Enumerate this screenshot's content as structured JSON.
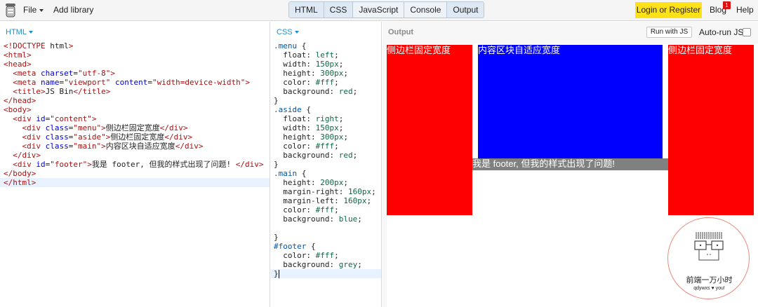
{
  "topbar": {
    "file_label": "File",
    "add_library_label": "Add library",
    "tabs": [
      "HTML",
      "CSS",
      "JavaScript",
      "Console",
      "Output"
    ],
    "login_label": "Login or Register",
    "blog_label": "Blog",
    "blog_badge": "1",
    "help_label": "Help"
  },
  "html_panel": {
    "label": "HTML",
    "lines": [
      "<!DOCTYPE html>",
      "<html>",
      "<head>",
      "  <meta charset=\"utf-8\">",
      "  <meta name=\"viewport\" content=\"width=device-width\">",
      "  <title>JS Bin</title>",
      "</head>",
      "<body>",
      "  <div id=\"content\">",
      "    <div class=\"menu\">侧边栏固定宽度</div>",
      "    <div class=\"aside\">侧边栏固定宽度</div>",
      "    <div class=\"main\">内容区块自适应宽度</div>",
      "  </div>",
      "  <div id=\"footer\">我是 footer, 但我的样式出现了问题! </div>",
      "</body>",
      "</html>"
    ]
  },
  "css_panel": {
    "label": "CSS",
    "lines": [
      ".menu {",
      "  float: left;",
      "  width: 150px;",
      "  height: 300px;",
      "  color: #fff;",
      "  background: red;",
      "}",
      ".aside {",
      "  float: right;",
      "  width: 150px;",
      "  height: 300px;",
      "  color: #fff;",
      "  background: red;",
      "}",
      ".main {",
      "  height: 200px;",
      "  margin-right: 160px;",
      "  margin-left: 160px;",
      "  color: #fff;",
      "  background: blue;",
      "",
      "}",
      "#footer {",
      "  color: #fff;",
      "  background: grey;",
      "}"
    ]
  },
  "output_panel": {
    "title": "Output",
    "run_label": "Run with JS",
    "autorun_label": "Auto-run JS",
    "autorun_checked": false,
    "menu_text": "侧边栏固定宽度",
    "main_text": "内容区块自适应宽度",
    "aside_text": "侧边栏固定宽度",
    "footer_text": "我是 footer, 但我的样式出现了问题!"
  },
  "watermark": {
    "title": "前端一万小时",
    "subtitle": "qdywxs ♥ you!"
  },
  "colors": {
    "accent": "#1d8fd3",
    "login_bg": "#ffe11a",
    "menu_bg": "#ff0000",
    "main_bg": "#0000ff",
    "footer_bg": "#808080"
  }
}
